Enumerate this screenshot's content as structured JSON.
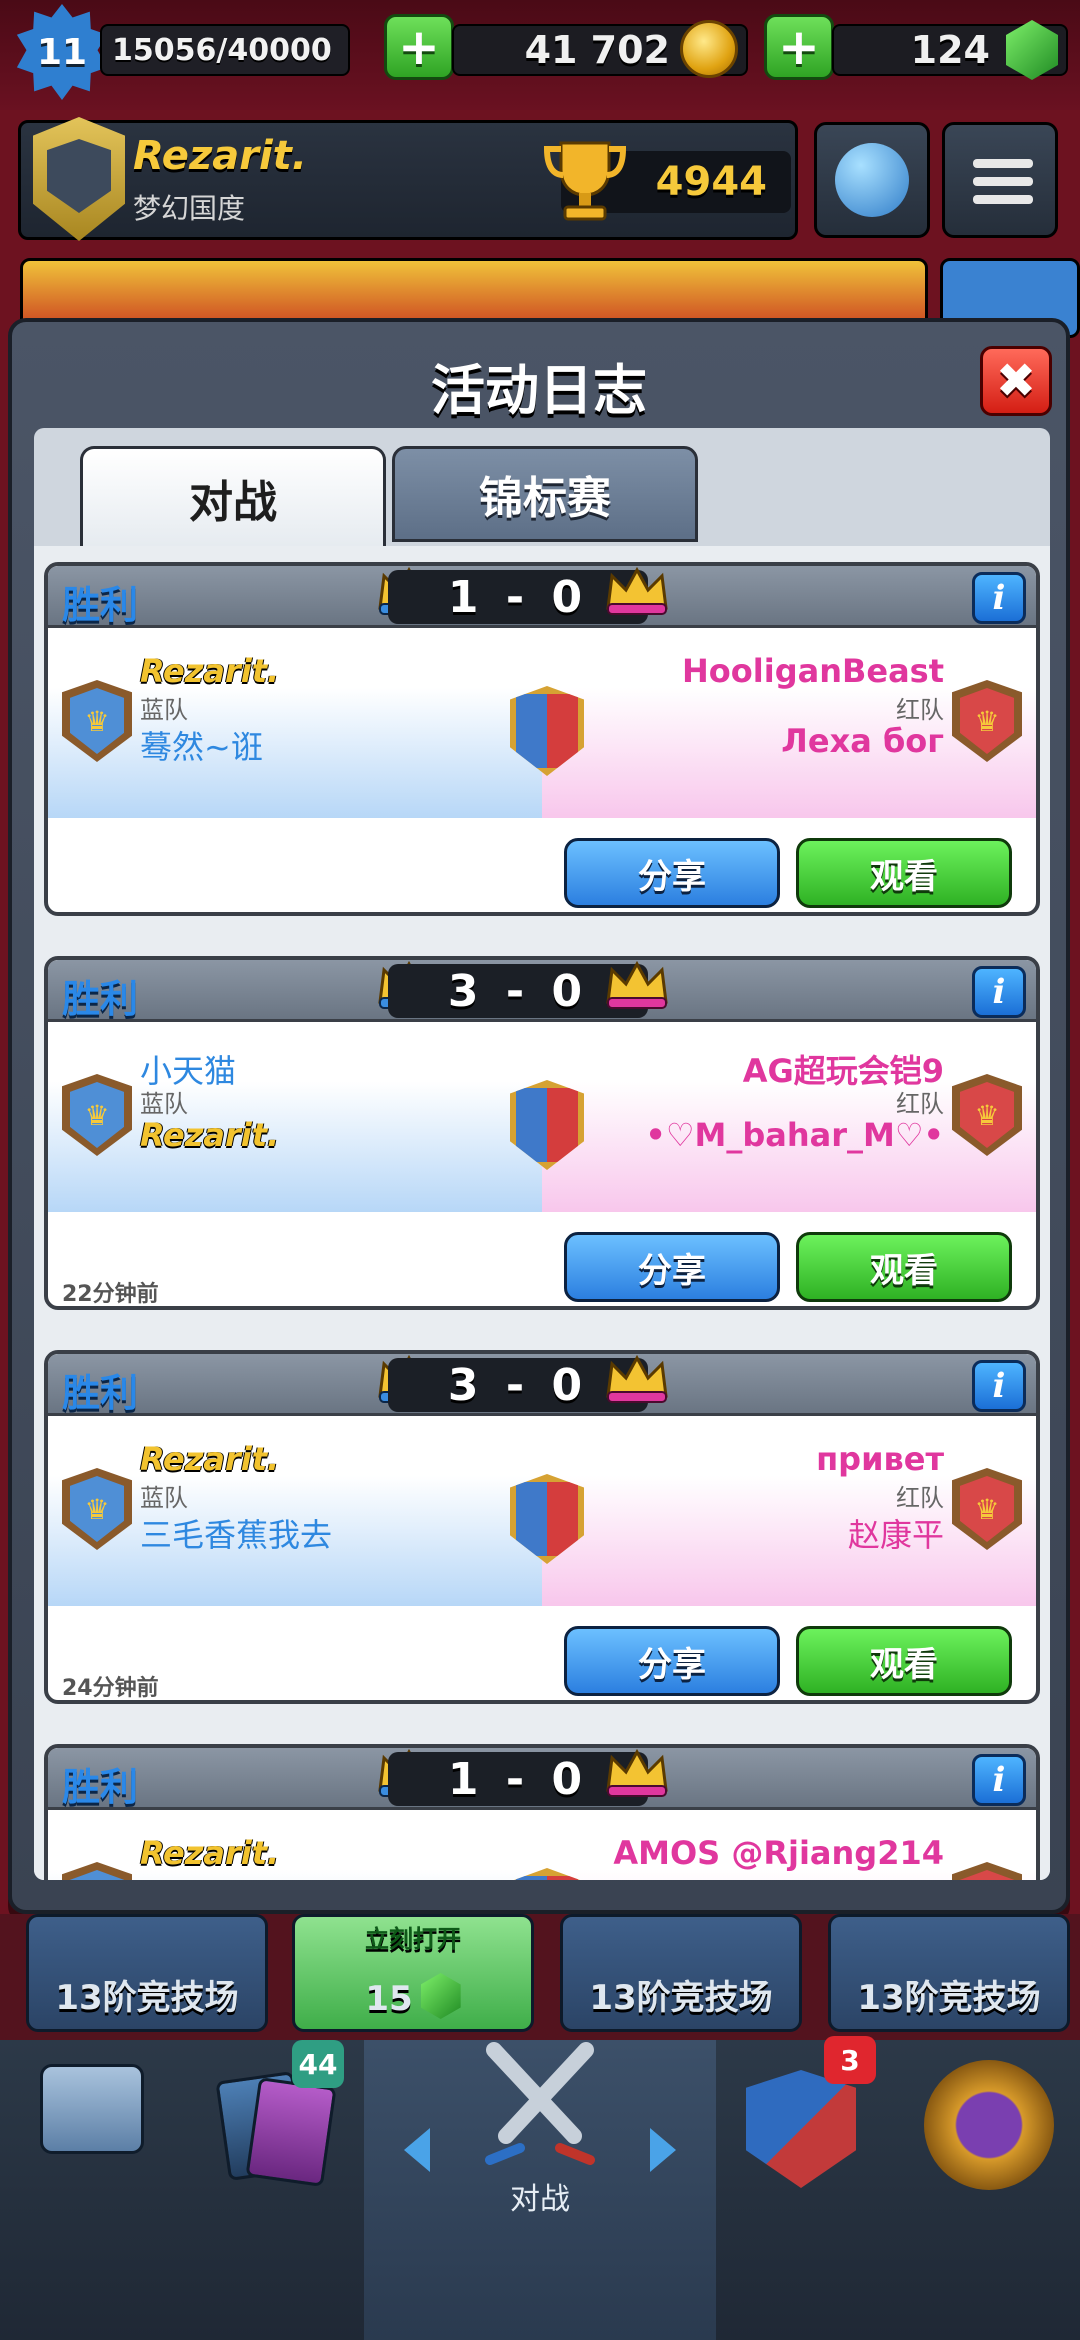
{
  "hud": {
    "level": "11",
    "xp": "15056/40000",
    "gold": "41 702",
    "gems": "124",
    "plus_label": "+"
  },
  "profile": {
    "name": "Rezarit.",
    "clan": "梦幻国度",
    "trophies": "4944"
  },
  "modal": {
    "title": "活动日志",
    "close_label": "✖",
    "tabs": [
      {
        "label": "对战",
        "active": true
      },
      {
        "label": "锦标赛",
        "active": false
      }
    ]
  },
  "battles": [
    {
      "result": "胜利",
      "score_left": "1",
      "score_sep": "-",
      "score_right": "0",
      "info_label": "i",
      "blue": {
        "player1": "Rezarit.",
        "team": "蓝队",
        "player2": "蓦然~诳"
      },
      "red": {
        "player1": "HooliganBeast",
        "team": "红队",
        "player2": "Леха бог"
      },
      "share_label": "分享",
      "watch_label": "观看",
      "time": ""
    },
    {
      "result": "胜利",
      "score_left": "3",
      "score_sep": "-",
      "score_right": "0",
      "info_label": "i",
      "blue": {
        "player1": "小天猫",
        "team": "蓝队",
        "player2": "Rezarit."
      },
      "red": {
        "player1": "AG超玩会铠9",
        "team": "红队",
        "player2": "•♡M_bahar_M♡•"
      },
      "share_label": "分享",
      "watch_label": "观看",
      "time": "22分钟前"
    },
    {
      "result": "胜利",
      "score_left": "3",
      "score_sep": "-",
      "score_right": "0",
      "info_label": "i",
      "blue": {
        "player1": "Rezarit.",
        "team": "蓝队",
        "player2": "三毛香蕉我去"
      },
      "red": {
        "player1": "привет",
        "team": "红队",
        "player2": "赵康平"
      },
      "share_label": "分享",
      "watch_label": "观看",
      "time": "24分钟前"
    },
    {
      "result": "胜利",
      "score_left": "1",
      "score_sep": "-",
      "score_right": "0",
      "info_label": "i",
      "blue": {
        "player1": "Rezarit.",
        "team": "",
        "player2": ""
      },
      "red": {
        "player1": "AMOS @Rjiang214",
        "team": "",
        "player2": ""
      }
    }
  ],
  "chests": [
    {
      "label": "13阶竞技场"
    },
    {
      "top_label": "立刻打开",
      "label": "15"
    },
    {
      "label": "13阶竞技场"
    },
    {
      "label": "13阶竞技场"
    }
  ],
  "nav": {
    "cards_badge": "44",
    "battle_label": "对战",
    "clan_badge": "3"
  },
  "colors": {
    "victory_blue": "#2a88e8",
    "gold_name": "#f2c32f",
    "red_team_pink": "#e0379e",
    "share_blue": "#2c7fe0",
    "watch_green": "#2fb224",
    "close_red": "#d41e14"
  }
}
